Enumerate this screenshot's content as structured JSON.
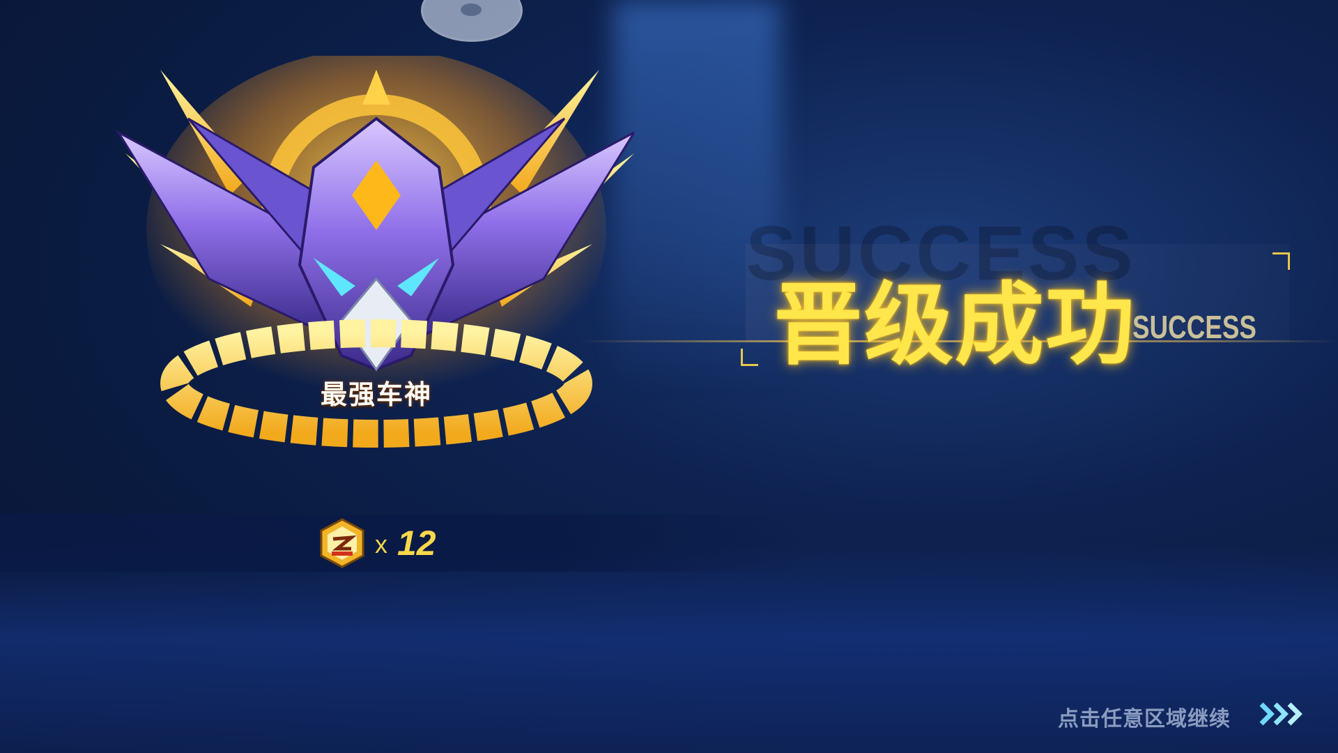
{
  "emblem": {
    "rank_name": "最强车神",
    "icon_name": "dragon-crest-emblem-icon"
  },
  "reward": {
    "icon_name": "rank-coin-icon",
    "multiplier": "x",
    "count": "12"
  },
  "banner": {
    "ghost_text": "SUCCESS",
    "title": "晋级成功",
    "subtitle": "SUCCESS"
  },
  "continue": {
    "label": "点击任意区域继续",
    "icon_name": "triple-chevron-right-icon"
  },
  "colors": {
    "accent_gold": "#ffe64a",
    "background_navy": "#0e2352",
    "emblem_purple": "#7a6ad8"
  }
}
